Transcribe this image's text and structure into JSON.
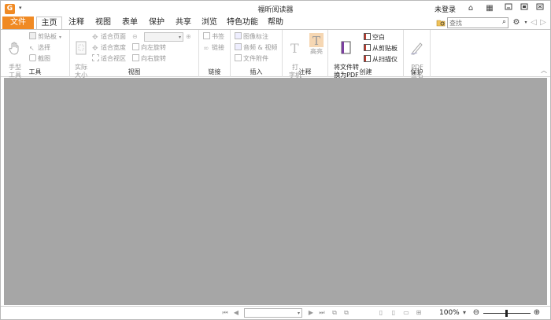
{
  "titlebar": {
    "app_logo_letter": "G",
    "title": "福昕阅读器",
    "login": "未登录",
    "icons": [
      "quick-access-arrow-icon",
      "ribbon-display-icon",
      "restore-grid-icon",
      "minimize-icon",
      "maximize-icon",
      "close-icon"
    ]
  },
  "menu": {
    "file": "文件",
    "tabs": [
      "主页",
      "注释",
      "视图",
      "表单",
      "保护",
      "共享",
      "浏览",
      "特色功能",
      "帮助"
    ],
    "active_tab": "主页"
  },
  "search": {
    "placeholder": "查找"
  },
  "ribbon": {
    "tools": {
      "label": "工具",
      "hand": "手型\n工具",
      "clipboard": "剪贴板",
      "select": "选择",
      "snapshot": "截图"
    },
    "view": {
      "label": "视图",
      "actual_size": "实际\n大小",
      "fit_page": "适合页面",
      "fit_width": "适合宽度",
      "fit_visible": "适合视区",
      "rotate_left": "向左旋转",
      "rotate_right": "向右旋转"
    },
    "links": {
      "label": "链接",
      "bookmark": "书签",
      "link": "链接"
    },
    "insert": {
      "label": "插入",
      "image": "图像标注",
      "audio_video": "音频 & 视频",
      "attach": "文件附件"
    },
    "comment": {
      "label": "注释",
      "typewriter": "打\n字机",
      "highlight": "高亮"
    },
    "create": {
      "label": "创建",
      "convert": "将文件转\n换为PDF",
      "blank": "空白",
      "from_clipboard": "从剪贴板",
      "from_scanner": "从扫描仪"
    },
    "protect": {
      "label": "保护",
      "sign": "PDF\n签名"
    }
  },
  "status": {
    "zoom": "100%"
  },
  "colors": {
    "accent": "#f08a24",
    "doc_bg": "#a6a6a6"
  }
}
